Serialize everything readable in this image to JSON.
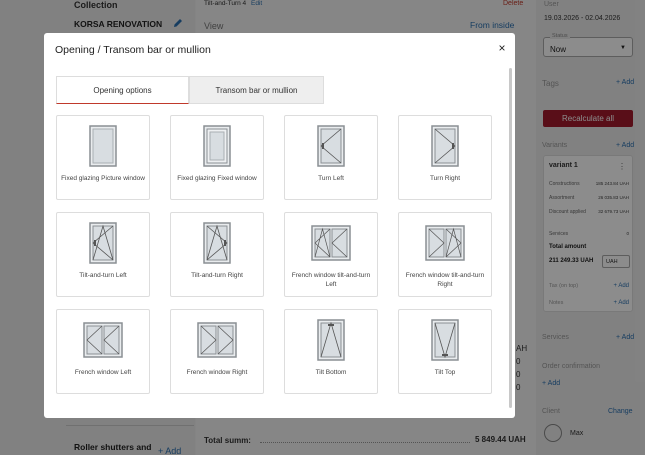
{
  "background": {
    "left": {
      "collection_label": "Collection",
      "company": "KORSA RENOVATION",
      "roller_label": "Roller shutters and",
      "roller_add": "+ Add"
    },
    "mid": {
      "item_name": "Tilt-and-Turn 4",
      "edit_link": "Edit",
      "delete_link": "Delete",
      "view_label": "View",
      "from_inside": "From inside",
      "total_label": "Total summ:",
      "total_value": "5 849.44 UAH",
      "side_digits": [
        "AH",
        "0",
        "0",
        "0"
      ]
    },
    "right": {
      "user_label": "User",
      "date_range": "19.03.2026 - 02.04.2026",
      "status_legend": "Status",
      "status_value": "Now",
      "tags_label": "Tags",
      "tags_add": "+ Add",
      "recalc_button": "Recalculate all",
      "variants_label": "Variants",
      "variants_add": "+ Add",
      "variant": {
        "name": "variant 1",
        "rows": [
          {
            "label": "Constructions",
            "value": "185 243.84 UAH"
          },
          {
            "label": "Assortment",
            "value": "26 035.83 UAH"
          },
          {
            "label": "Discount applied",
            "value": "32 679.73 UAH"
          },
          {
            "label": "Services",
            "value": "0"
          }
        ],
        "total_amount_label": "Total amount",
        "total_amount": "211 249.33 UAH",
        "currency": "UAH",
        "tax_label": "Tax (on top)",
        "tax_add": "+ Add",
        "notes_label": "Notes",
        "notes_add": "+ Add"
      },
      "services_label": "Services",
      "services_add": "+ Add",
      "order_confirmation_label": "Order confirmation",
      "order_add": "+ Add",
      "client_label": "Client",
      "client_change": "Change",
      "client_name": "Max"
    }
  },
  "modal": {
    "title": "Opening / Transom bar or mullion",
    "close_glyph": "×",
    "tabs": [
      {
        "label": "Opening options",
        "active": true
      },
      {
        "label": "Transom bar or mullion",
        "active": false
      }
    ],
    "options": [
      {
        "label": "Fixed glazing Picture window",
        "icon": "fixed-picture-window-icon"
      },
      {
        "label": "Fixed glazing Fixed window",
        "icon": "fixed-window-icon"
      },
      {
        "label": "Turn Left",
        "icon": "turn-left-icon"
      },
      {
        "label": "Turn Right",
        "icon": "turn-right-icon"
      },
      {
        "label": "Tilt-and-turn Left",
        "icon": "tilt-turn-left-icon"
      },
      {
        "label": "Tilt-and-turn Right",
        "icon": "tilt-turn-right-icon"
      },
      {
        "label": "French window tilt-and-turn Left",
        "icon": "french-tilt-turn-left-icon"
      },
      {
        "label": "French window tilt-and-turn Right",
        "icon": "french-tilt-turn-right-icon"
      },
      {
        "label": "French window Left",
        "icon": "french-left-icon"
      },
      {
        "label": "French window Right",
        "icon": "french-right-icon"
      },
      {
        "label": "Tilt Bottom",
        "icon": "tilt-bottom-icon"
      },
      {
        "label": "Tilt Top",
        "icon": "tilt-top-icon"
      }
    ]
  }
}
